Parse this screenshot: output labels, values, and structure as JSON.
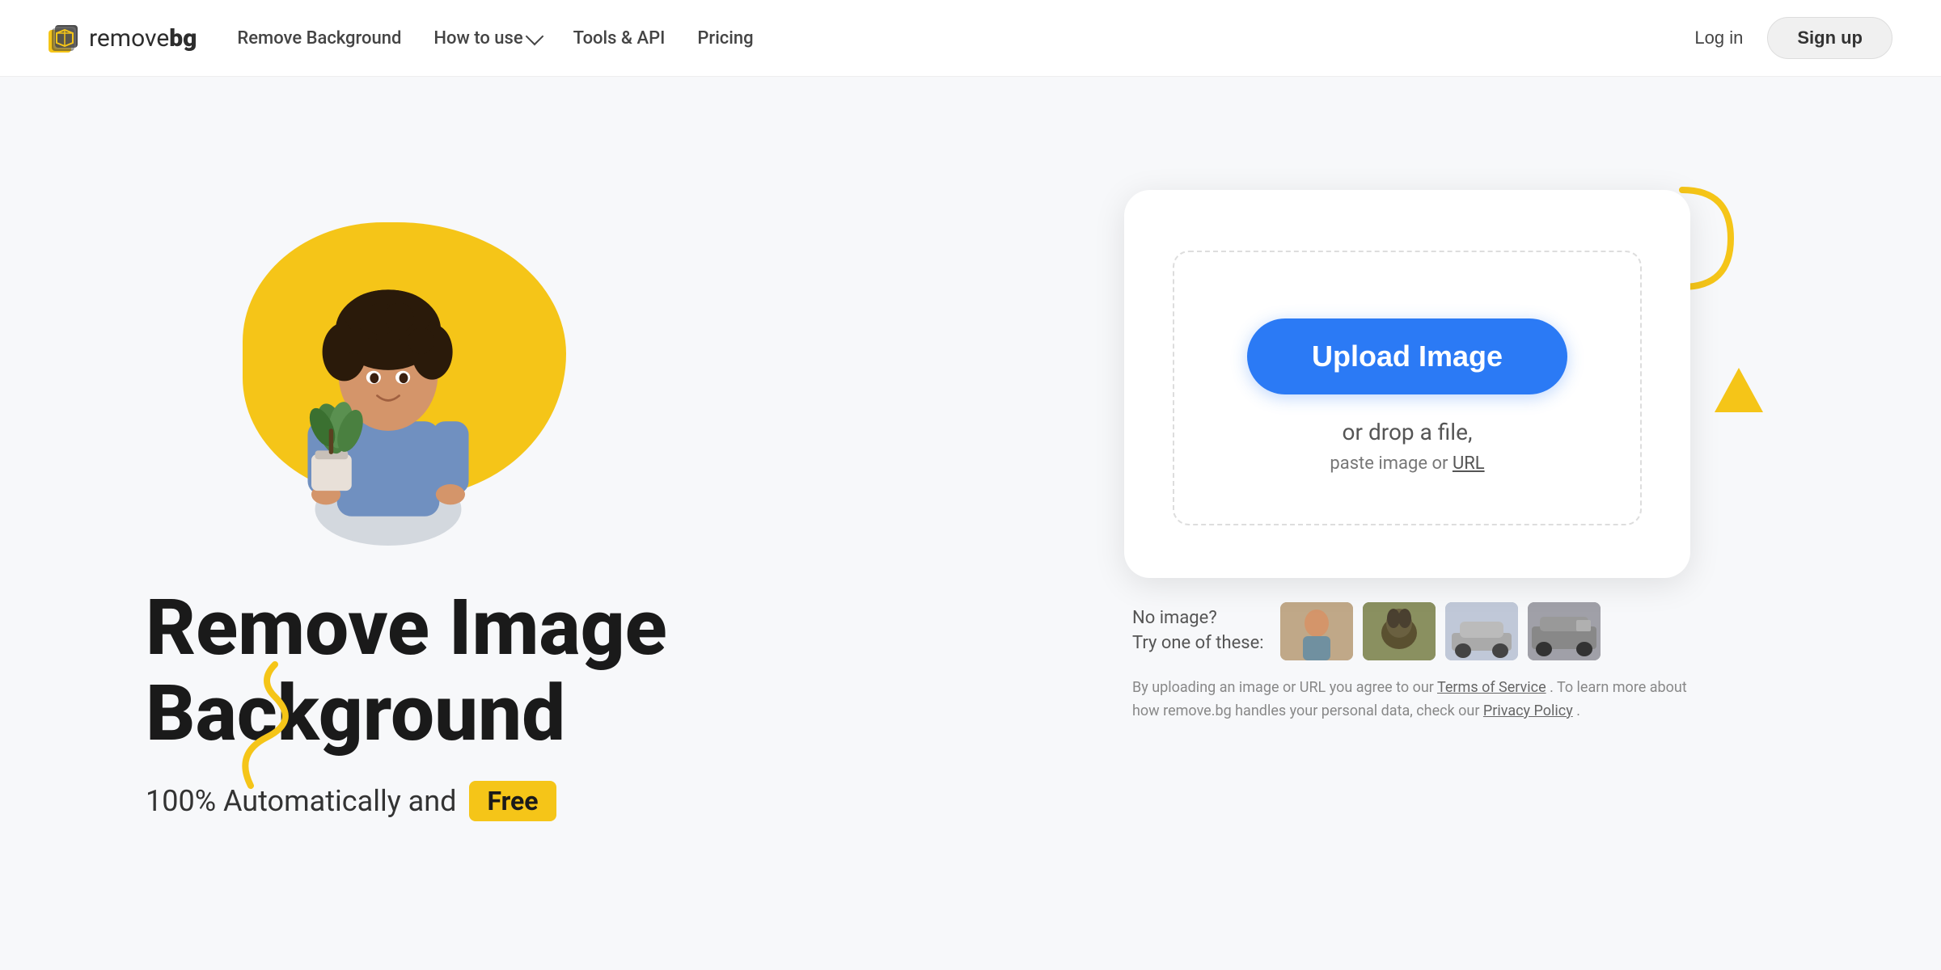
{
  "navbar": {
    "logo_text_remove": "remove",
    "logo_text_bg": "bg",
    "nav_items": [
      {
        "label": "Remove Background",
        "has_dropdown": false
      },
      {
        "label": "How to use",
        "has_dropdown": true
      },
      {
        "label": "Tools & API",
        "has_dropdown": false
      },
      {
        "label": "Pricing",
        "has_dropdown": false
      }
    ],
    "login_label": "Log in",
    "signup_label": "Sign up"
  },
  "hero": {
    "title_line1": "Remove Image",
    "title_line2": "Background",
    "subtitle_text": "100% Automatically and",
    "badge_text": "Free"
  },
  "upload": {
    "button_label": "Upload Image",
    "drop_text": "or drop a file,",
    "paste_text": "paste image or",
    "paste_link": "URL"
  },
  "samples": {
    "label_line1": "No image?",
    "label_line2": "Try one of these:",
    "items": [
      {
        "label": "person-thumb",
        "color": "#c8b0a0"
      },
      {
        "label": "animal-thumb",
        "color": "#7a8050"
      },
      {
        "label": "car-thumb",
        "color": "#b0baca"
      },
      {
        "label": "vehicle-thumb",
        "color": "#909090"
      }
    ]
  },
  "legal": {
    "text": "By uploading an image or URL you agree to our",
    "tos_link": "Terms of Service",
    "text2": ". To learn more about how remove.bg handles your personal data, check our",
    "privacy_link": "Privacy Policy",
    "text3": "."
  }
}
